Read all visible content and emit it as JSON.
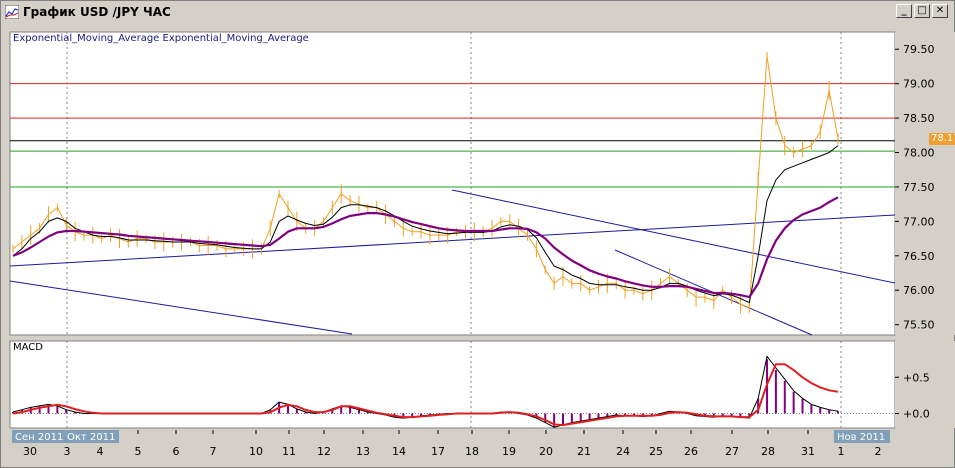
{
  "window": {
    "title": "График USD /JPY  ЧАС",
    "buttons": {
      "minimize": "_",
      "maximize": "□",
      "close": "✕"
    }
  },
  "indicators": {
    "main_legend": "Exponential_Moving_Average Exponential_Moving_Average",
    "macd_label": "MACD"
  },
  "current_price": "78.17",
  "colors": {
    "price": "#f0a020",
    "ema_fast": "#000000",
    "ema_slow": "#800080",
    "trendline": "#1a1a9a",
    "resistance": "#e02020",
    "support": "#20a020",
    "current": "#000000",
    "macd_signal": "#e02020",
    "macd_hist": "#800080"
  },
  "chart_data": [
    {
      "type": "line",
      "title": "",
      "y_ticks": [
        "79.50",
        "79.00",
        "78.50",
        "78.00",
        "77.50",
        "77.00",
        "76.50",
        "76.00",
        "75.50"
      ],
      "ylim": [
        75.35,
        79.75
      ],
      "x_labels": [
        "30",
        "3",
        "4",
        "5",
        "6",
        "7",
        "10",
        "11",
        "12",
        "13",
        "14",
        "17",
        "18",
        "19",
        "20",
        "21",
        "24",
        "25",
        "26",
        "27",
        "28",
        "31",
        "1",
        "2"
      ],
      "period_labels": [
        "Сен 2011",
        "Окт 2011",
        "Нов 2011"
      ],
      "horizontal_levels": {
        "red": [
          79.0,
          78.5
        ],
        "black": [
          78.17
        ],
        "green": [
          78.02,
          77.5
        ]
      },
      "series": [
        {
          "values": [
            76.6,
            76.7,
            76.8,
            76.9,
            77.1,
            77.2,
            76.95,
            76.85,
            76.8,
            76.8,
            76.75,
            76.8,
            76.75,
            76.7,
            76.75,
            76.75,
            76.7,
            76.7,
            76.7,
            76.7,
            76.7,
            76.65,
            76.65,
            76.65,
            76.6,
            76.6,
            76.6,
            76.6,
            76.6,
            76.9,
            77.4,
            77.2,
            77.0,
            76.9,
            76.9,
            77.0,
            77.2,
            77.4,
            77.3,
            77.25,
            77.2,
            77.2,
            77.1,
            77.0,
            76.9,
            76.85,
            76.85,
            76.8,
            76.8,
            76.8,
            76.85,
            76.85,
            76.85,
            76.85,
            76.9,
            77.0,
            77.0,
            76.9,
            76.8,
            76.6,
            76.3,
            76.1,
            76.2,
            76.1,
            76.1,
            76.0,
            76.05,
            76.1,
            76.1,
            76.0,
            76.0,
            75.95,
            76.0,
            76.1,
            76.2,
            76.1,
            76.0,
            75.9,
            75.9,
            75.85,
            76.0,
            75.9,
            75.8,
            75.75,
            77.6,
            79.4,
            78.5,
            78.1,
            78.0,
            78.05,
            78.1,
            78.3,
            78.9,
            78.2
          ]
        },
        {
          "values": [
            76.5,
            76.6,
            76.75,
            76.85,
            77.0,
            77.05,
            77.0,
            76.9,
            76.85,
            76.8,
            76.78,
            76.78,
            76.76,
            76.73,
            76.73,
            76.73,
            76.72,
            76.71,
            76.7,
            76.7,
            76.7,
            76.68,
            76.67,
            76.66,
            76.64,
            76.62,
            76.61,
            76.6,
            76.6,
            76.7,
            77.0,
            77.08,
            77.02,
            76.97,
            76.94,
            76.96,
            77.06,
            77.2,
            77.24,
            77.24,
            77.22,
            77.2,
            77.15,
            77.08,
            77.0,
            76.93,
            76.89,
            76.86,
            76.84,
            76.82,
            76.83,
            76.84,
            76.84,
            76.84,
            76.86,
            76.92,
            76.95,
            76.93,
            76.88,
            76.76,
            76.55,
            76.35,
            76.3,
            76.22,
            76.17,
            76.1,
            76.08,
            76.08,
            76.08,
            76.05,
            76.03,
            76.0,
            76.0,
            76.04,
            76.1,
            76.1,
            76.06,
            76.0,
            75.96,
            75.92,
            75.95,
            75.93,
            75.88,
            75.82,
            76.5,
            77.3,
            77.6,
            77.75,
            77.8,
            77.85,
            77.9,
            77.95,
            78.0,
            78.1
          ]
        },
        {
          "values": [
            76.5,
            76.55,
            76.62,
            76.7,
            76.78,
            76.84,
            76.86,
            76.86,
            76.85,
            76.84,
            76.83,
            76.82,
            76.81,
            76.79,
            76.78,
            76.77,
            76.76,
            76.75,
            76.74,
            76.73,
            76.72,
            76.71,
            76.7,
            76.69,
            76.68,
            76.67,
            76.66,
            76.65,
            76.64,
            76.66,
            76.75,
            76.85,
            76.9,
            76.9,
            76.9,
            76.92,
            76.97,
            77.03,
            77.08,
            77.1,
            77.12,
            77.12,
            77.1,
            77.07,
            77.03,
            76.99,
            76.96,
            76.93,
            76.9,
            76.88,
            76.87,
            76.86,
            76.86,
            76.86,
            76.86,
            76.88,
            76.9,
            76.9,
            76.89,
            76.84,
            76.75,
            76.62,
            76.52,
            76.43,
            76.36,
            76.29,
            76.24,
            76.2,
            76.17,
            76.13,
            76.1,
            76.07,
            76.05,
            76.05,
            76.06,
            76.06,
            76.05,
            76.02,
            75.99,
            75.96,
            75.96,
            75.95,
            75.93,
            75.9,
            76.1,
            76.45,
            76.72,
            76.9,
            77.02,
            77.1,
            77.15,
            77.2,
            77.28,
            77.35
          ]
        }
      ]
    },
    {
      "type": "bar",
      "title": "",
      "y_ticks": [
        "+0.5",
        "+0.0"
      ],
      "ylim": [
        -0.2,
        1.0
      ],
      "hist": [
        0.02,
        0.05,
        0.08,
        0.1,
        0.12,
        0.1,
        0.05,
        0.02,
        0.0,
        0.0,
        0.0,
        0.0,
        0.0,
        0.0,
        0.0,
        0.0,
        0.0,
        0.0,
        0.0,
        0.0,
        0.0,
        0.0,
        0.0,
        0.0,
        0.0,
        0.0,
        0.0,
        0.0,
        0.0,
        0.05,
        0.15,
        0.12,
        0.06,
        0.02,
        0.0,
        0.02,
        0.06,
        0.1,
        0.08,
        0.05,
        0.02,
        0.0,
        -0.02,
        -0.05,
        -0.06,
        -0.05,
        -0.03,
        -0.02,
        -0.01,
        0.0,
        0.0,
        0.0,
        0.0,
        0.0,
        0.0,
        0.02,
        0.02,
        0.0,
        -0.02,
        -0.06,
        -0.12,
        -0.18,
        -0.15,
        -0.12,
        -0.1,
        -0.08,
        -0.06,
        -0.04,
        -0.02,
        -0.03,
        -0.03,
        -0.04,
        -0.03,
        0.0,
        0.03,
        0.02,
        0.0,
        -0.03,
        -0.04,
        -0.05,
        -0.03,
        -0.04,
        -0.05,
        -0.06,
        0.2,
        0.75,
        0.6,
        0.45,
        0.3,
        0.2,
        0.12,
        0.08,
        0.05,
        0.03
      ],
      "signal": [
        0.0,
        0.02,
        0.05,
        0.08,
        0.1,
        0.12,
        0.1,
        0.06,
        0.03,
        0.01,
        0.0,
        0.0,
        0.0,
        0.0,
        0.0,
        0.0,
        0.0,
        0.0,
        0.0,
        0.0,
        0.0,
        0.0,
        0.0,
        0.0,
        0.0,
        0.0,
        0.0,
        0.0,
        0.0,
        0.02,
        0.08,
        0.12,
        0.1,
        0.05,
        0.02,
        0.02,
        0.05,
        0.1,
        0.1,
        0.07,
        0.04,
        0.01,
        -0.01,
        -0.03,
        -0.05,
        -0.05,
        -0.04,
        -0.03,
        -0.02,
        -0.01,
        0.0,
        0.0,
        0.0,
        0.0,
        0.0,
        0.01,
        0.02,
        0.01,
        -0.01,
        -0.04,
        -0.09,
        -0.15,
        -0.16,
        -0.14,
        -0.12,
        -0.1,
        -0.08,
        -0.06,
        -0.04,
        -0.03,
        -0.03,
        -0.03,
        -0.03,
        -0.02,
        0.01,
        0.02,
        0.01,
        -0.01,
        -0.03,
        -0.04,
        -0.04,
        -0.04,
        -0.05,
        -0.05,
        0.05,
        0.4,
        0.68,
        0.68,
        0.6,
        0.5,
        0.42,
        0.36,
        0.32,
        0.3
      ]
    }
  ]
}
